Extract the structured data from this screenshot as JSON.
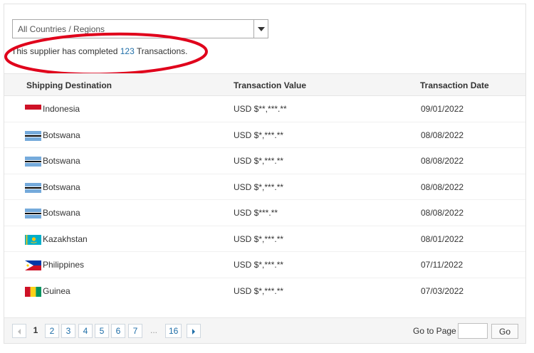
{
  "filter": {
    "selected_value": "All Countries / Regions"
  },
  "summary": {
    "prefix": "This supplier has completed ",
    "count": "123",
    "suffix": " Transactions."
  },
  "table": {
    "headers": {
      "destination": "Shipping Destination",
      "value": "Transaction Value",
      "date": "Transaction Date"
    },
    "rows": [
      {
        "destination": "Indonesia",
        "flag": "indonesia-flag-icon",
        "value": "USD $**,***.**",
        "date": "09/01/2022"
      },
      {
        "destination": "Botswana",
        "flag": "botswana-flag-icon",
        "value": "USD $*,***.**",
        "date": "08/08/2022"
      },
      {
        "destination": "Botswana",
        "flag": "botswana-flag-icon",
        "value": "USD $*,***.**",
        "date": "08/08/2022"
      },
      {
        "destination": "Botswana",
        "flag": "botswana-flag-icon",
        "value": "USD $*,***.**",
        "date": "08/08/2022"
      },
      {
        "destination": "Botswana",
        "flag": "botswana-flag-icon",
        "value": "USD $***.**",
        "date": "08/08/2022"
      },
      {
        "destination": "Kazakhstan",
        "flag": "kazakhstan-flag-icon",
        "value": "USD $*,***.**",
        "date": "08/01/2022"
      },
      {
        "destination": "Philippines",
        "flag": "philippines-flag-icon",
        "value": "USD $*,***.**",
        "date": "07/11/2022"
      },
      {
        "destination": "Guinea",
        "flag": "guinea-flag-icon",
        "value": "USD $*,***.**",
        "date": "07/03/2022"
      }
    ]
  },
  "pagination": {
    "current": "1",
    "pages": [
      "2",
      "3",
      "4",
      "5",
      "6",
      "7"
    ],
    "ellipsis": "...",
    "last": "16",
    "goto_label": "Go to Page",
    "goto_value": "",
    "go_button": "Go"
  },
  "colors": {
    "link_blue": "#1f6ea8",
    "highlight_red": "#e0001b",
    "header_bg": "#f5f5f5"
  }
}
